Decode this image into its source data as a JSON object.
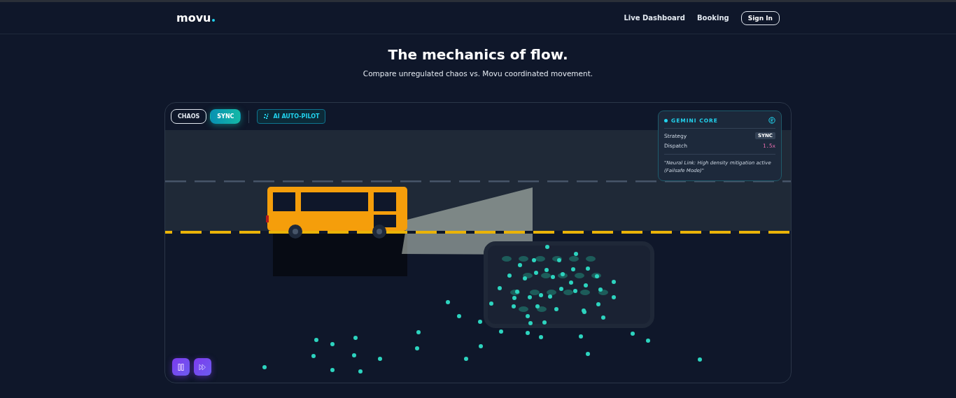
{
  "nav": {
    "logo": "movu",
    "links": [
      "Live Dashboard",
      "Booking"
    ],
    "signin": "Sign In"
  },
  "hero": {
    "title": "The mechanics of flow.",
    "subtitle": "Compare unregulated chaos vs. Movu coordinated movement."
  },
  "modes": [
    {
      "label": "CHAOS",
      "selected": false
    },
    {
      "label": "SYNC",
      "selected": true
    }
  ],
  "autopilot": {
    "label": "AI AUTO-PILOT"
  },
  "panel": {
    "title": "GEMINI CORE",
    "rows": [
      {
        "label": "Strategy",
        "value": "SYNC",
        "kind": "tag"
      },
      {
        "label": "Dispatch",
        "value": "1.5x",
        "kind": "mono"
      }
    ],
    "note": "\"Neural Link: High density mitigation active (Failsafe Mode)\""
  },
  "controls": [
    {
      "kind": "pause"
    },
    {
      "kind": "fast-forward"
    }
  ]
}
